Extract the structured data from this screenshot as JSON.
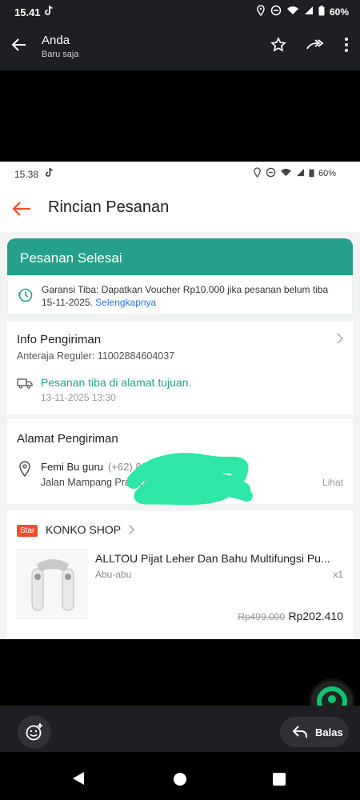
{
  "viewer": {
    "status": {
      "time": "15.41",
      "battery": "60%"
    },
    "header": {
      "title": "Anda",
      "subtitle": "Baru saja"
    },
    "reply_label": "Balas"
  },
  "screenshot": {
    "status": {
      "time": "15.38",
      "battery": "60%"
    },
    "page_title": "Rincian Pesanan",
    "banner": "Pesanan Selesai",
    "guarantee": {
      "text": "Garansi Tiba: Dapatkan Voucher Rp10.000 jika pesanan belum tiba 15-11-2025.",
      "link": "Selengkapnya"
    },
    "shipping": {
      "heading": "Info Pengiriman",
      "courier": "Anteraja Reguler: 11002884604037",
      "status": "Pesanan tiba di alamat tujuan.",
      "datetime": "13-11-2025 13:30"
    },
    "address": {
      "heading": "Alamat Pengiriman",
      "name": "Femi Bu guru",
      "phone": "(+62) 821",
      "line": "Jalan Mampang Prapa                            03, KOTA JA...",
      "more": "Lihat"
    },
    "shop": {
      "badge": "Star",
      "name": "KONKO SHOP",
      "product": "ALLTOU Pijat Leher Dan Bahu Multifungsi Pu...",
      "variant": "Abu-abu",
      "qty": "x1",
      "old_price": "Rp499.000",
      "price": "Rp202.410"
    }
  },
  "colors": {
    "accent": "#26a08a",
    "orange": "#ee4d2d",
    "link": "#2673dd"
  }
}
